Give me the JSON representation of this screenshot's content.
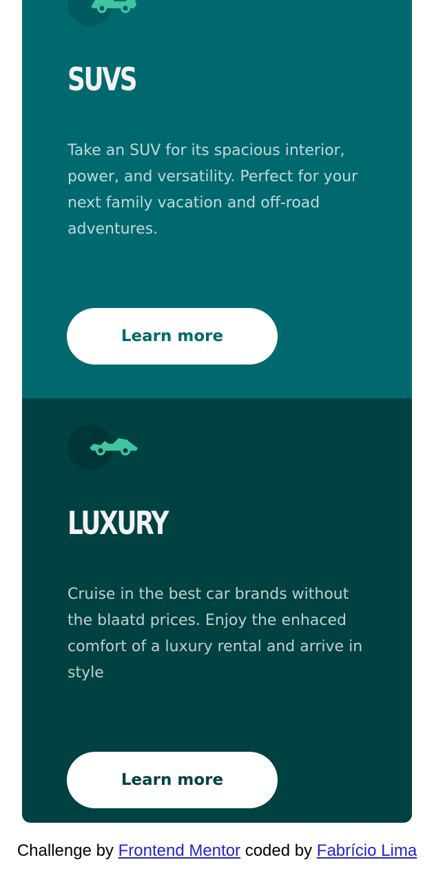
{
  "cards": [
    {
      "id": "suvs",
      "icon": "suv-car-icon",
      "title": "SUVS",
      "text": "Take an SUV for its spacious interior, power, and versatility. Perfect for your next family vacation and off-road adventures.",
      "button_label": "Learn more",
      "background_color": "#006970"
    },
    {
      "id": "luxury",
      "icon": "luxury-car-icon",
      "title": "LUXURY",
      "text": "Cruise in the best car brands without the blaatd prices. Enjoy the enhaced comfort of a luxury rental and arrive in style",
      "button_label": "Learn more",
      "background_color": "#004241"
    }
  ],
  "attribution": {
    "prefix": "Challenge by",
    "challenge_link": "Frontend Mentor",
    "middle": "coded by",
    "author_link": "Fabrício Lima"
  },
  "colors": {
    "icon_accent": "#3fc5a1",
    "link": "#2323cf"
  }
}
